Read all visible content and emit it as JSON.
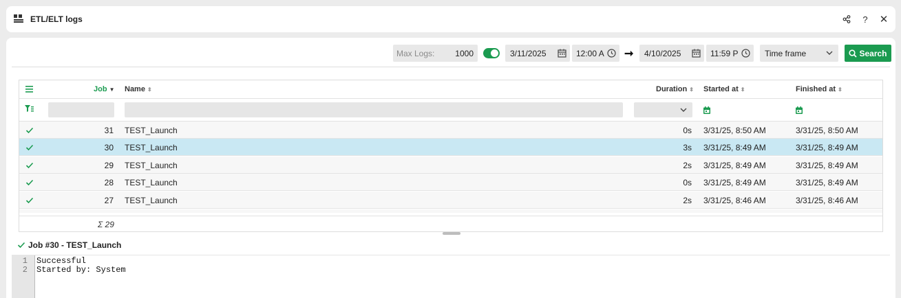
{
  "window": {
    "title": "ETL/ELT logs",
    "icon": "grid-app-icon",
    "share_icon": "share-icon",
    "help_label": "?",
    "close_label": "✕"
  },
  "toolbar": {
    "max_logs_label": "Max Logs:",
    "max_logs_value": "1000",
    "toggle_on": true,
    "from_date": "3/11/2025",
    "from_time": "12:00 A",
    "to_date": "4/10/2025",
    "to_time": "11:59 P",
    "arrow": "➞",
    "timeframe_value": "Time frame",
    "search_label": "Search",
    "accent": "#1b9b50"
  },
  "grid": {
    "columns": {
      "job": "Job",
      "name": "Name",
      "duration": "Duration",
      "started": "Started at",
      "finished": "Finished at"
    },
    "rows": [
      {
        "job": "31",
        "name": "TEST_Launch",
        "duration": "0s",
        "started": "3/31/25, 8:50 AM",
        "finished": "3/31/25, 8:50 AM",
        "selected": false
      },
      {
        "job": "30",
        "name": "TEST_Launch",
        "duration": "3s",
        "started": "3/31/25, 8:49 AM",
        "finished": "3/31/25, 8:49 AM",
        "selected": true
      },
      {
        "job": "29",
        "name": "TEST_Launch",
        "duration": "2s",
        "started": "3/31/25, 8:49 AM",
        "finished": "3/31/25, 8:49 AM",
        "selected": false
      },
      {
        "job": "28",
        "name": "TEST_Launch",
        "duration": "0s",
        "started": "3/31/25, 8:49 AM",
        "finished": "3/31/25, 8:49 AM",
        "selected": false
      },
      {
        "job": "27",
        "name": "TEST_Launch",
        "duration": "2s",
        "started": "3/31/25, 8:46 AM",
        "finished": "3/31/25, 8:46 AM",
        "selected": false
      }
    ],
    "footer_sum": "Σ 29"
  },
  "detail": {
    "title": "Job #30 - TEST_Launch",
    "lines": [
      {
        "n": "1",
        "text": "Successful"
      },
      {
        "n": "2",
        "text": "Started by: System"
      }
    ]
  }
}
